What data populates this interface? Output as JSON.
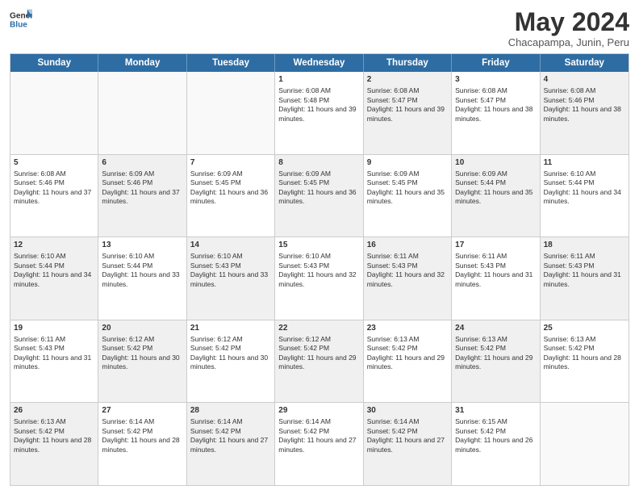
{
  "header": {
    "logo_general": "General",
    "logo_blue": "Blue",
    "month_title": "May 2024",
    "location": "Chacapampa, Junin, Peru"
  },
  "days_of_week": [
    "Sunday",
    "Monday",
    "Tuesday",
    "Wednesday",
    "Thursday",
    "Friday",
    "Saturday"
  ],
  "weeks": [
    [
      {
        "num": "",
        "text": "",
        "empty": true
      },
      {
        "num": "",
        "text": "",
        "empty": true
      },
      {
        "num": "",
        "text": "",
        "empty": true
      },
      {
        "num": "1",
        "text": "Sunrise: 6:08 AM\nSunset: 5:48 PM\nDaylight: 11 hours and 39 minutes.",
        "empty": false,
        "shaded": false
      },
      {
        "num": "2",
        "text": "Sunrise: 6:08 AM\nSunset: 5:47 PM\nDaylight: 11 hours and 39 minutes.",
        "empty": false,
        "shaded": true
      },
      {
        "num": "3",
        "text": "Sunrise: 6:08 AM\nSunset: 5:47 PM\nDaylight: 11 hours and 38 minutes.",
        "empty": false,
        "shaded": false
      },
      {
        "num": "4",
        "text": "Sunrise: 6:08 AM\nSunset: 5:46 PM\nDaylight: 11 hours and 38 minutes.",
        "empty": false,
        "shaded": true
      }
    ],
    [
      {
        "num": "5",
        "text": "Sunrise: 6:08 AM\nSunset: 5:46 PM\nDaylight: 11 hours and 37 minutes.",
        "empty": false,
        "shaded": false
      },
      {
        "num": "6",
        "text": "Sunrise: 6:09 AM\nSunset: 5:46 PM\nDaylight: 11 hours and 37 minutes.",
        "empty": false,
        "shaded": true
      },
      {
        "num": "7",
        "text": "Sunrise: 6:09 AM\nSunset: 5:45 PM\nDaylight: 11 hours and 36 minutes.",
        "empty": false,
        "shaded": false
      },
      {
        "num": "8",
        "text": "Sunrise: 6:09 AM\nSunset: 5:45 PM\nDaylight: 11 hours and 36 minutes.",
        "empty": false,
        "shaded": true
      },
      {
        "num": "9",
        "text": "Sunrise: 6:09 AM\nSunset: 5:45 PM\nDaylight: 11 hours and 35 minutes.",
        "empty": false,
        "shaded": false
      },
      {
        "num": "10",
        "text": "Sunrise: 6:09 AM\nSunset: 5:44 PM\nDaylight: 11 hours and 35 minutes.",
        "empty": false,
        "shaded": true
      },
      {
        "num": "11",
        "text": "Sunrise: 6:10 AM\nSunset: 5:44 PM\nDaylight: 11 hours and 34 minutes.",
        "empty": false,
        "shaded": false
      }
    ],
    [
      {
        "num": "12",
        "text": "Sunrise: 6:10 AM\nSunset: 5:44 PM\nDaylight: 11 hours and 34 minutes.",
        "empty": false,
        "shaded": true
      },
      {
        "num": "13",
        "text": "Sunrise: 6:10 AM\nSunset: 5:44 PM\nDaylight: 11 hours and 33 minutes.",
        "empty": false,
        "shaded": false
      },
      {
        "num": "14",
        "text": "Sunrise: 6:10 AM\nSunset: 5:43 PM\nDaylight: 11 hours and 33 minutes.",
        "empty": false,
        "shaded": true
      },
      {
        "num": "15",
        "text": "Sunrise: 6:10 AM\nSunset: 5:43 PM\nDaylight: 11 hours and 32 minutes.",
        "empty": false,
        "shaded": false
      },
      {
        "num": "16",
        "text": "Sunrise: 6:11 AM\nSunset: 5:43 PM\nDaylight: 11 hours and 32 minutes.",
        "empty": false,
        "shaded": true
      },
      {
        "num": "17",
        "text": "Sunrise: 6:11 AM\nSunset: 5:43 PM\nDaylight: 11 hours and 31 minutes.",
        "empty": false,
        "shaded": false
      },
      {
        "num": "18",
        "text": "Sunrise: 6:11 AM\nSunset: 5:43 PM\nDaylight: 11 hours and 31 minutes.",
        "empty": false,
        "shaded": true
      }
    ],
    [
      {
        "num": "19",
        "text": "Sunrise: 6:11 AM\nSunset: 5:43 PM\nDaylight: 11 hours and 31 minutes.",
        "empty": false,
        "shaded": false
      },
      {
        "num": "20",
        "text": "Sunrise: 6:12 AM\nSunset: 5:42 PM\nDaylight: 11 hours and 30 minutes.",
        "empty": false,
        "shaded": true
      },
      {
        "num": "21",
        "text": "Sunrise: 6:12 AM\nSunset: 5:42 PM\nDaylight: 11 hours and 30 minutes.",
        "empty": false,
        "shaded": false
      },
      {
        "num": "22",
        "text": "Sunrise: 6:12 AM\nSunset: 5:42 PM\nDaylight: 11 hours and 29 minutes.",
        "empty": false,
        "shaded": true
      },
      {
        "num": "23",
        "text": "Sunrise: 6:13 AM\nSunset: 5:42 PM\nDaylight: 11 hours and 29 minutes.",
        "empty": false,
        "shaded": false
      },
      {
        "num": "24",
        "text": "Sunrise: 6:13 AM\nSunset: 5:42 PM\nDaylight: 11 hours and 29 minutes.",
        "empty": false,
        "shaded": true
      },
      {
        "num": "25",
        "text": "Sunrise: 6:13 AM\nSunset: 5:42 PM\nDaylight: 11 hours and 28 minutes.",
        "empty": false,
        "shaded": false
      }
    ],
    [
      {
        "num": "26",
        "text": "Sunrise: 6:13 AM\nSunset: 5:42 PM\nDaylight: 11 hours and 28 minutes.",
        "empty": false,
        "shaded": true
      },
      {
        "num": "27",
        "text": "Sunrise: 6:14 AM\nSunset: 5:42 PM\nDaylight: 11 hours and 28 minutes.",
        "empty": false,
        "shaded": false
      },
      {
        "num": "28",
        "text": "Sunrise: 6:14 AM\nSunset: 5:42 PM\nDaylight: 11 hours and 27 minutes.",
        "empty": false,
        "shaded": true
      },
      {
        "num": "29",
        "text": "Sunrise: 6:14 AM\nSunset: 5:42 PM\nDaylight: 11 hours and 27 minutes.",
        "empty": false,
        "shaded": false
      },
      {
        "num": "30",
        "text": "Sunrise: 6:14 AM\nSunset: 5:42 PM\nDaylight: 11 hours and 27 minutes.",
        "empty": false,
        "shaded": true
      },
      {
        "num": "31",
        "text": "Sunrise: 6:15 AM\nSunset: 5:42 PM\nDaylight: 11 hours and 26 minutes.",
        "empty": false,
        "shaded": false
      },
      {
        "num": "",
        "text": "",
        "empty": true
      }
    ]
  ]
}
